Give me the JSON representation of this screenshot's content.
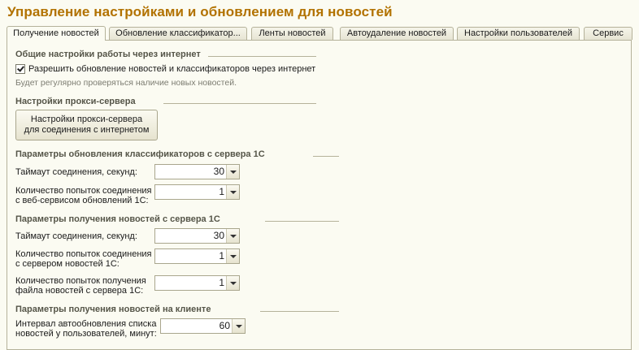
{
  "title": "Управление настройками и обновлением для новостей",
  "tabs": [
    {
      "label": "Получение новостей"
    },
    {
      "label": "Обновление классификатор..."
    },
    {
      "label": "Ленты новостей"
    },
    {
      "label": "Автоудаление новостей"
    },
    {
      "label": "Настройки пользователей"
    },
    {
      "label": "Сервис"
    }
  ],
  "internet": {
    "group": "Общие настройки работы через интернет",
    "checkbox_label": "Разрешить обновление новостей и классификаторов через интернет",
    "checked": true,
    "hint": "Будет регулярно проверяться наличие новых новостей."
  },
  "proxy": {
    "group": "Настройки прокси-сервера",
    "button_line1": "Настройки прокси-сервера",
    "button_line2": "для соединения с интернетом"
  },
  "classifiers": {
    "group": "Параметры обновления классификаторов с сервера 1С",
    "timeout_label": "Таймаут соединения, секунд:",
    "timeout_value": "30",
    "attempts_label1": "Количество попыток соединения",
    "attempts_label2": "с веб-сервисом обновлений 1С:",
    "attempts_value": "1"
  },
  "news": {
    "group": "Параметры получения новостей с сервера 1С",
    "timeout_label": "Таймаут соединения, секунд:",
    "timeout_value": "30",
    "attempts_label1": "Количество попыток соединения",
    "attempts_label2": "с сервером новостей 1С:",
    "attempts_value": "1",
    "file_attempts_label1": "Количество попыток получения",
    "file_attempts_label2": "файла новостей с сервера 1С:",
    "file_attempts_value": "1"
  },
  "client": {
    "group": "Параметры получения новостей на клиенте",
    "interval_label1": "Интервал автообновления списка",
    "interval_label2": "новостей у пользователей, минут:",
    "interval_value": "60"
  }
}
